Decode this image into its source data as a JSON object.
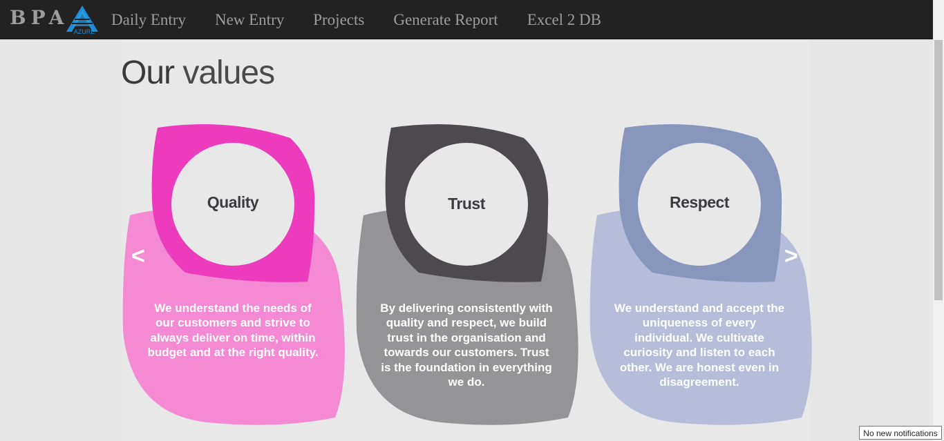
{
  "navbar": {
    "brand": "BPA",
    "logo_text": "AZURE",
    "links": [
      "Daily Entry",
      "New Entry",
      "Projects",
      "Generate Report",
      "Excel 2 DB"
    ]
  },
  "page": {
    "heading_bold": "Our",
    "heading_light": "values"
  },
  "values": [
    {
      "title": "Quality",
      "description": "We understand the needs of our customers and strive to always deliver on time, within budget and at the right quality.",
      "accent_color": "#ec3bbd",
      "back_color": "#f489d4"
    },
    {
      "title": "Trust",
      "description": "By delivering consistently with quality and respect, we build trust in the organisation and towards our customers. Trust is the foundation in everything we do.",
      "accent_color": "#4d4a4f",
      "back_color": "#949395"
    },
    {
      "title": "Respect",
      "description": "We understand and accept the uniqueness of every individual. We cultivate curiosity and listen to each other. We are honest even in disagreement.",
      "accent_color": "#8895bd",
      "back_color": "#b5bdd8"
    }
  ],
  "carousel": {
    "prev_label": "<",
    "next_label": ">"
  },
  "notification": "No new notifications"
}
